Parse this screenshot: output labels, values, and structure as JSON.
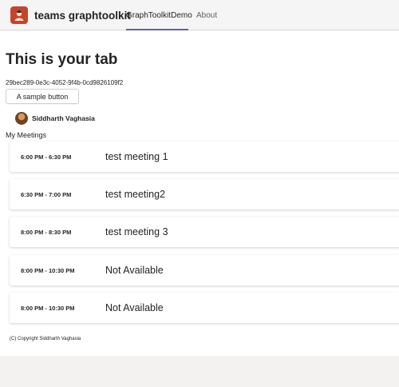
{
  "header": {
    "app_name": "teams graphtoolkit",
    "tabs": [
      {
        "label": "GraphToolkitDemo",
        "active": true
      },
      {
        "label": "About",
        "active": false
      }
    ],
    "accent_color": "#6264a7",
    "icon_color": "#c5442f"
  },
  "main": {
    "title": "This is your tab",
    "id_text": "29bec289-0e3c-4052-9f4b-0cd9826109f2",
    "button_label": "A sample button",
    "person_name": "Siddharth Vaghasia",
    "meetings_label": "My Meetings",
    "meetings": [
      {
        "time": "6:00 PM - 6:30 PM",
        "title": "test meeting 1"
      },
      {
        "time": "6:30 PM - 7:00 PM",
        "title": "test meeting2"
      },
      {
        "time": "8:00 PM - 8:30 PM",
        "title": "test meeting 3"
      },
      {
        "time": "8:00 PM - 10:30 PM",
        "title": "Not Available"
      },
      {
        "time": "8:00 PM - 10:30 PM",
        "title": "Not Available"
      }
    ],
    "copyright": "(C) Copyright Siddharth Vaghasia"
  }
}
